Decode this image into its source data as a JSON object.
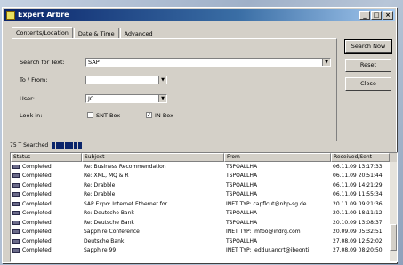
{
  "window": {
    "title": "Expert Arbre"
  },
  "titlebar_buttons": [
    "_",
    "□",
    "×"
  ],
  "tabs": [
    "Contents/Location",
    "Date & Time",
    "Advanced"
  ],
  "form": {
    "search_label": "Search for Text:",
    "search_value": "SAP",
    "to_from_label": "To / From:",
    "to_from_value": "",
    "user_label": "User:",
    "user_value": "JC",
    "look_in_label": "Look in:",
    "sent_box_label": "SNT Box",
    "in_box_label": "IN Box",
    "sent_box_checked": false,
    "in_box_checked": true
  },
  "buttons": {
    "search_now": "Search Now",
    "reset": "Reset",
    "close": "Close"
  },
  "status": {
    "text": "75 T Searched",
    "progress": 1.0
  },
  "table": {
    "columns": [
      "Status",
      "Subject",
      "From",
      "Received/Sent"
    ],
    "rows": [
      [
        "Completed",
        "Re: Business Recommendation",
        "TSPOALLHA",
        "06.11.09 13:17:33"
      ],
      [
        "Completed",
        "Re: XML, MQ & R",
        "TSPOALLHA",
        "06.11.09 20:51:44"
      ],
      [
        "Completed",
        "Re: Drabble",
        "TSPOALLHA",
        "06.11.09 14:21:29"
      ],
      [
        "Completed",
        "Re: Drabble",
        "TSPOALLHA",
        "06.11.09 11:55:34"
      ],
      [
        "Completed",
        "SAP Expo: Internet Ethernet for",
        "INET TYP: capflcut@nbp-sg.de",
        "20.11.09 09:21:36"
      ],
      [
        "Completed",
        "Re: Deutsche Bank",
        "TSPOALLHA",
        "20.11.09 18:11:12"
      ],
      [
        "Completed",
        "Re: Deutsche Bank",
        "TSPOALLHA",
        "20.10.09 13:08:37"
      ],
      [
        "Completed",
        "Sapphire Conference",
        "INET TYP: lmfoo@indrg.com",
        "20.09.09 05:32:51"
      ],
      [
        "Completed",
        "Deutsche Bank",
        "TSPOALLHA",
        "27.08.09 12:52:02"
      ],
      [
        "Completed",
        "Sapphire 99",
        "INET TYP: jeddur.ancrt@ibeonti",
        "27.08.09 08:20:50"
      ]
    ]
  }
}
